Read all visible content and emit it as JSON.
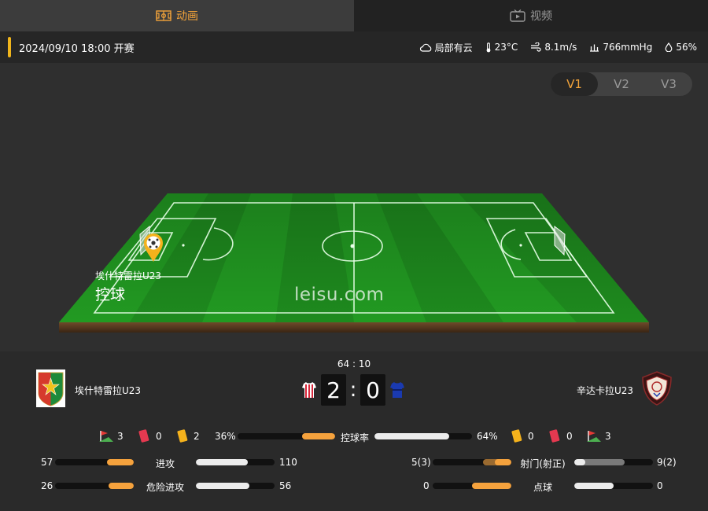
{
  "tabs": [
    {
      "label": "动画",
      "icon": "pitch-icon",
      "active": true
    },
    {
      "label": "视频",
      "icon": "tv-icon",
      "active": false
    }
  ],
  "match_info": {
    "kickoff": "2024/09/10 18:00 开赛",
    "weather": "局部有云",
    "temperature": "23°C",
    "wind": "8.1m/s",
    "pressure": "766mmHg",
    "humidity": "56%"
  },
  "views": [
    "V1",
    "V2",
    "V3"
  ],
  "active_view": "V1",
  "animation": {
    "team": "埃什特雷拉U23",
    "event": "控球",
    "watermark": "leisu.com"
  },
  "score": {
    "minute": "64 : 10",
    "home_team": "埃什特雷拉U23",
    "away_team": "辛达卡拉U23",
    "home_goals": "2",
    "away_goals": "0",
    "separator": ":"
  },
  "cards": {
    "home": {
      "corners": "3",
      "red": "0",
      "yellow": "2"
    },
    "away": {
      "yellow": "0",
      "red": "0",
      "corners": "3"
    }
  },
  "possession": {
    "label": "控球率",
    "home": "36%",
    "away": "64%",
    "home_value": 36,
    "away_value": 64
  },
  "stats": [
    {
      "label": "进攻",
      "home": "57",
      "away": "110",
      "home_value": 57,
      "away_value": 110
    },
    {
      "label": "危险进攻",
      "home": "26",
      "away": "56",
      "home_value": 26,
      "away_value": 56
    },
    {
      "label": "射门(射正)",
      "home": "5(3)",
      "away": "9(2)",
      "home_value": 5,
      "away_value": 9,
      "home_on": 3,
      "away_on": 2
    },
    {
      "label": "点球",
      "home": "0",
      "away": "0",
      "home_value": 0,
      "away_value": 0
    }
  ],
  "colors": {
    "accent": "#f2a33a",
    "home_bar": "#f5a23d",
    "away_bar": "#ececec",
    "pitch": "#1f8a1f"
  }
}
